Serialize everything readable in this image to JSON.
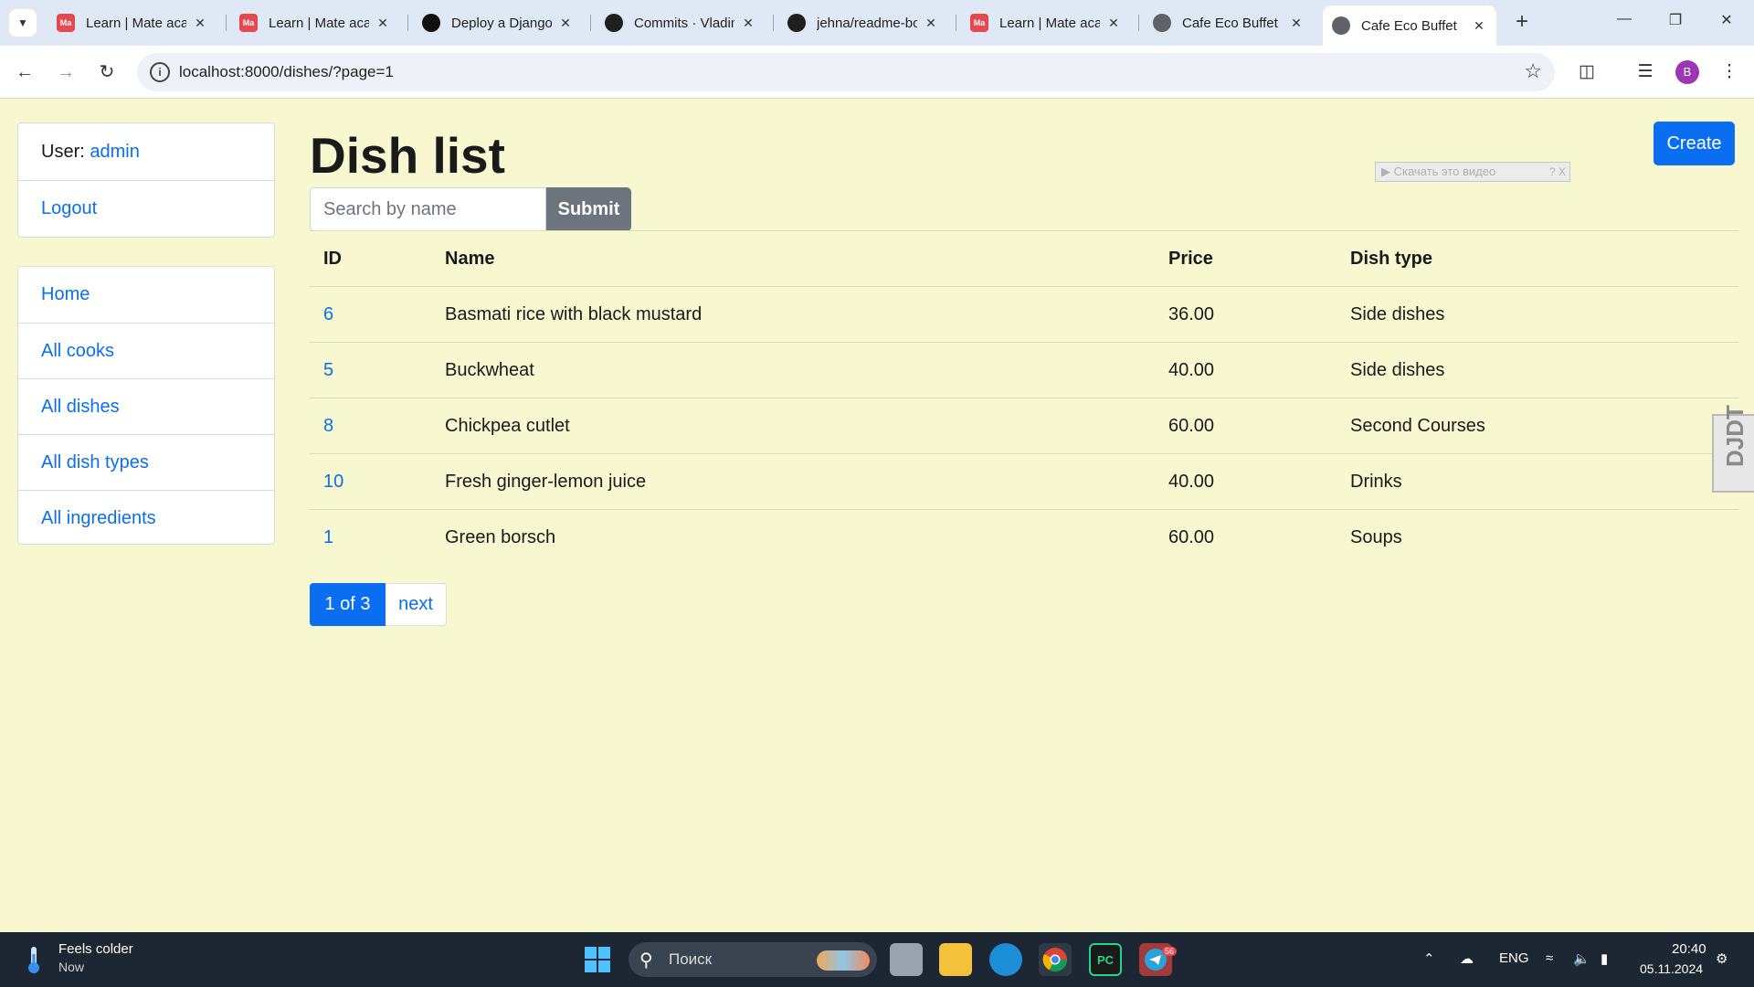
{
  "browser": {
    "tabs": [
      {
        "title": "Learn | Mate academy",
        "favicon": "mate-academy-icon"
      },
      {
        "title": "Learn | Mate academy",
        "favicon": "mate-academy-icon"
      },
      {
        "title": "Deploy a Django",
        "favicon": "render-icon"
      },
      {
        "title": "Commits · Vladim",
        "favicon": "github-icon"
      },
      {
        "title": "jehna/readme-bo",
        "favicon": "github-icon"
      },
      {
        "title": "Learn | Mate academy",
        "favicon": "mate-academy-icon"
      },
      {
        "title": "Cafe Eco Buffet",
        "favicon": "globe-icon"
      },
      {
        "title": "Cafe Eco Buffet",
        "favicon": "globe-icon",
        "active": true
      }
    ],
    "url": "localhost:8000/dishes/?page=1",
    "profile_initial": "B"
  },
  "sidebar": {
    "user_label": "User:",
    "username": "admin",
    "logout": "Logout",
    "nav": [
      "Home",
      "All cooks",
      "All dishes",
      "All dish types",
      "All ingredients"
    ]
  },
  "main": {
    "title": "Dish list",
    "create_label": "Create",
    "search": {
      "placeholder": "Search by name",
      "submit_label": "Submit"
    },
    "download_badge": "▶ Скачать это видео",
    "download_badge_ctrl": "? X",
    "table": {
      "headers": [
        "ID",
        "Name",
        "Price",
        "Dish type"
      ],
      "rows": [
        {
          "id": "6",
          "name": "Basmati rice with black mustard",
          "price": "36.00",
          "type": "Side dishes"
        },
        {
          "id": "5",
          "name": "Buckwheat",
          "price": "40.00",
          "type": "Side dishes"
        },
        {
          "id": "8",
          "name": "Chickpea cutlet",
          "price": "60.00",
          "type": "Second Courses"
        },
        {
          "id": "10",
          "name": "Fresh ginger-lemon juice",
          "price": "40.00",
          "type": "Drinks"
        },
        {
          "id": "1",
          "name": "Green borsch",
          "price": "60.00",
          "type": "Soups"
        }
      ]
    },
    "pagination": {
      "current": "1 of 3",
      "next": "next"
    },
    "debug_toolbar": "DJDT"
  },
  "taskbar": {
    "weather_title": "Feels colder",
    "weather_sub": "Now",
    "search_placeholder": "Поиск",
    "telegram_badge": "56",
    "language": "ENG",
    "time": "20:40",
    "date": "05.11.2024"
  },
  "colors": {
    "accent": "#0a6ef0",
    "page_bg": "#f7f7d0",
    "secondary_btn": "#6c757d",
    "taskbar": "#1d2733"
  }
}
